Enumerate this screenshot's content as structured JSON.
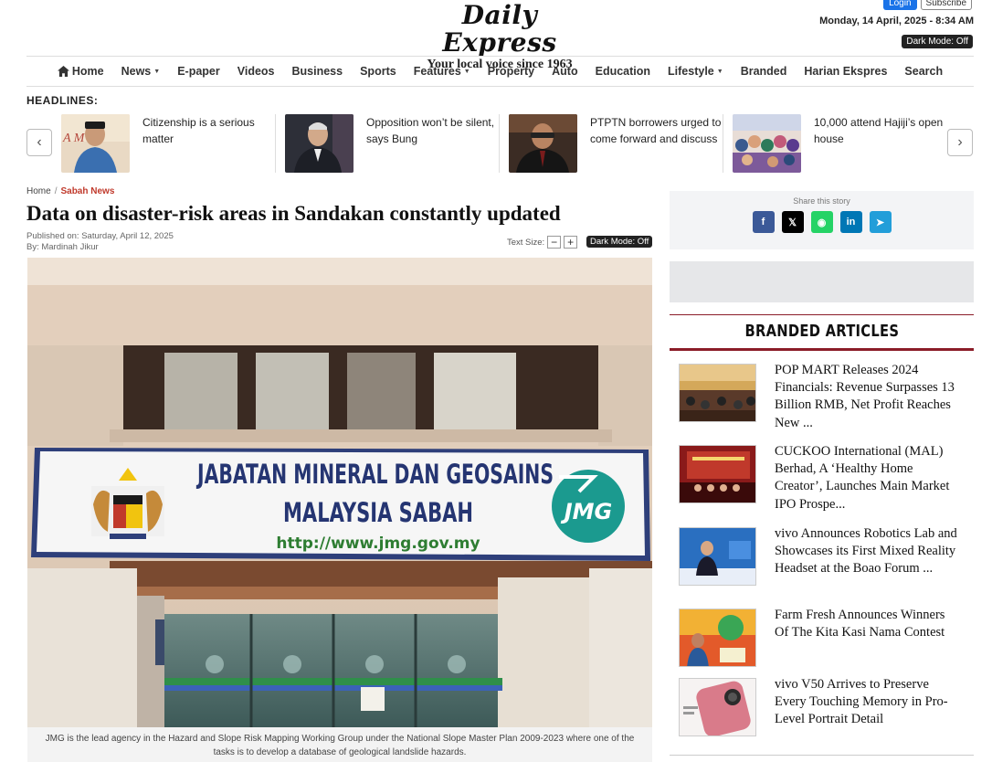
{
  "header": {
    "logo_title": "Daily Express",
    "logo_tagline": "Your local voice since 1963",
    "login_label": "Login",
    "subscribe_label": "Subscribe",
    "date_time": "Monday, 14 April, 2025 - 8:34 AM",
    "dark_mode_label": "Dark Mode: Off"
  },
  "nav": {
    "items": [
      "Home",
      "News",
      "E-paper",
      "Videos",
      "Business",
      "Sports",
      "Features",
      "Property",
      "Auto",
      "Education",
      "Lifestyle",
      "Branded",
      "Harian Ekspres",
      "Search"
    ]
  },
  "headlines": {
    "label": "HEADLINES:",
    "items": [
      {
        "title": "Citizenship is a serious matter"
      },
      {
        "title": "Opposition won’t be silent, says Bung"
      },
      {
        "title": "PTPTN borrowers urged to come forward and discuss"
      },
      {
        "title": "10,000 attend Hajiji’s open house"
      }
    ]
  },
  "article": {
    "breadcrumb_home": "Home",
    "breadcrumb_sep": "/",
    "breadcrumb_section": "Sabah News",
    "title": "Data on disaster-risk areas in Sandakan constantly updated",
    "published": "Published on: Saturday, April 12, 2025",
    "byline": "By: Mardinah Jikur",
    "text_size_label": "Text Size:",
    "dark_mode_label": "Dark Mode: Off",
    "photo_sign_line1": "JABATAN MINERAL DAN GEOSAINS",
    "photo_sign_line2": "MALAYSIA SABAH",
    "photo_sign_url": "http://www.jmg.gov.my",
    "photo_logo": "JMG",
    "caption": "JMG is the lead agency in the Hazard and Slope Risk Mapping Working Group under the National Slope Master Plan 2009-2023 where one of the tasks is to develop a database of geological landslide hazards."
  },
  "sidebar": {
    "share_label": "Share this story",
    "share_buttons": [
      {
        "glyph": "f",
        "color": "#3b5998"
      },
      {
        "glyph": "𝕏",
        "color": "#000000"
      },
      {
        "glyph": "◉",
        "color": "#25d366"
      },
      {
        "glyph": "in",
        "color": "#0077b5"
      },
      {
        "glyph": "➤",
        "color": "#229ed9"
      }
    ],
    "branded_heading": "BRANDED ARTICLES",
    "branded_items": [
      {
        "title": "POP MART Releases 2024 Financials: Revenue Surpasses 13 Billion RMB, Net Profit Reaches New ..."
      },
      {
        "title": "CUCKOO International (MAL) Berhad, A ‘Healthy Home Creator’, Launches Main Market IPO Prospe..."
      },
      {
        "title": "vivo Announces Robotics Lab and Showcases its First Mixed Reality Headset at the Boao Forum ..."
      },
      {
        "title": "Farm Fresh Announces Winners Of The Kita Kasi Nama Contest"
      },
      {
        "title": "vivo V50 Arrives to Preserve Every Touching Memory in Pro-Level Portrait Detail"
      }
    ]
  },
  "colors": {
    "accent_red": "#c0392b",
    "branded_rule": "#8b1c28",
    "login_blue": "#1a73e8"
  }
}
